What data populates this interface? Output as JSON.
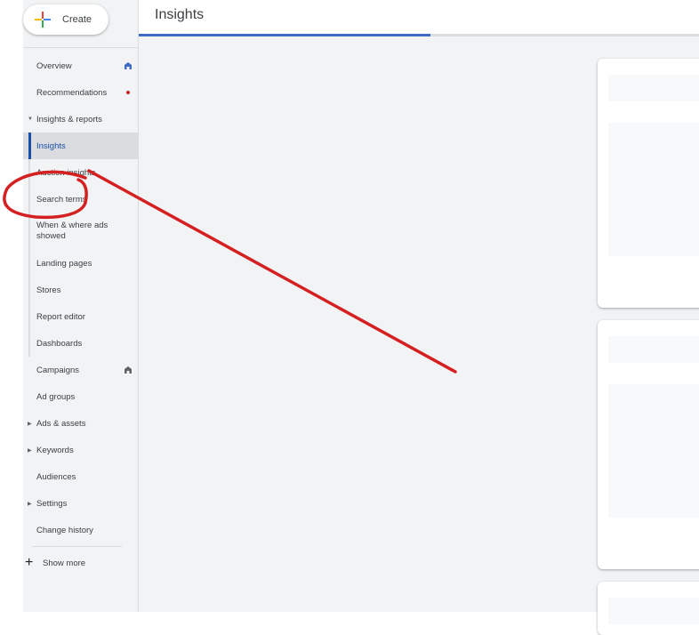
{
  "sidebar": {
    "create_label": "Create",
    "items": [
      {
        "label": "Overview",
        "icon": "home-icon"
      },
      {
        "label": "Recommendations",
        "badge": "red-dot"
      },
      {
        "label": "Insights & reports",
        "expanded": true
      },
      {
        "label": "Insights",
        "active": true
      },
      {
        "label": "Auction insights"
      },
      {
        "label": "Search terms"
      },
      {
        "label": "When & where ads showed"
      },
      {
        "label": "Landing pages"
      },
      {
        "label": "Stores"
      },
      {
        "label": "Report editor"
      },
      {
        "label": "Dashboards"
      },
      {
        "label": "Campaigns",
        "icon": "home-icon"
      },
      {
        "label": "Ad groups"
      },
      {
        "label": "Ads & assets",
        "collapsed": true
      },
      {
        "label": "Keywords",
        "collapsed": true
      },
      {
        "label": "Audiences"
      },
      {
        "label": "Settings",
        "collapsed": true
      },
      {
        "label": "Change history"
      }
    ],
    "show_more_label": "Show more"
  },
  "header": {
    "title": "Insights",
    "loading_progress": 0.52
  },
  "colors": {
    "accent": "#1a4fa8",
    "progress": "#3f6cc4",
    "annotation": "#d42020",
    "badge": "#c5221f"
  },
  "annotation": {
    "description": "red hand-drawn circle around 'Search terms' with a line"
  }
}
